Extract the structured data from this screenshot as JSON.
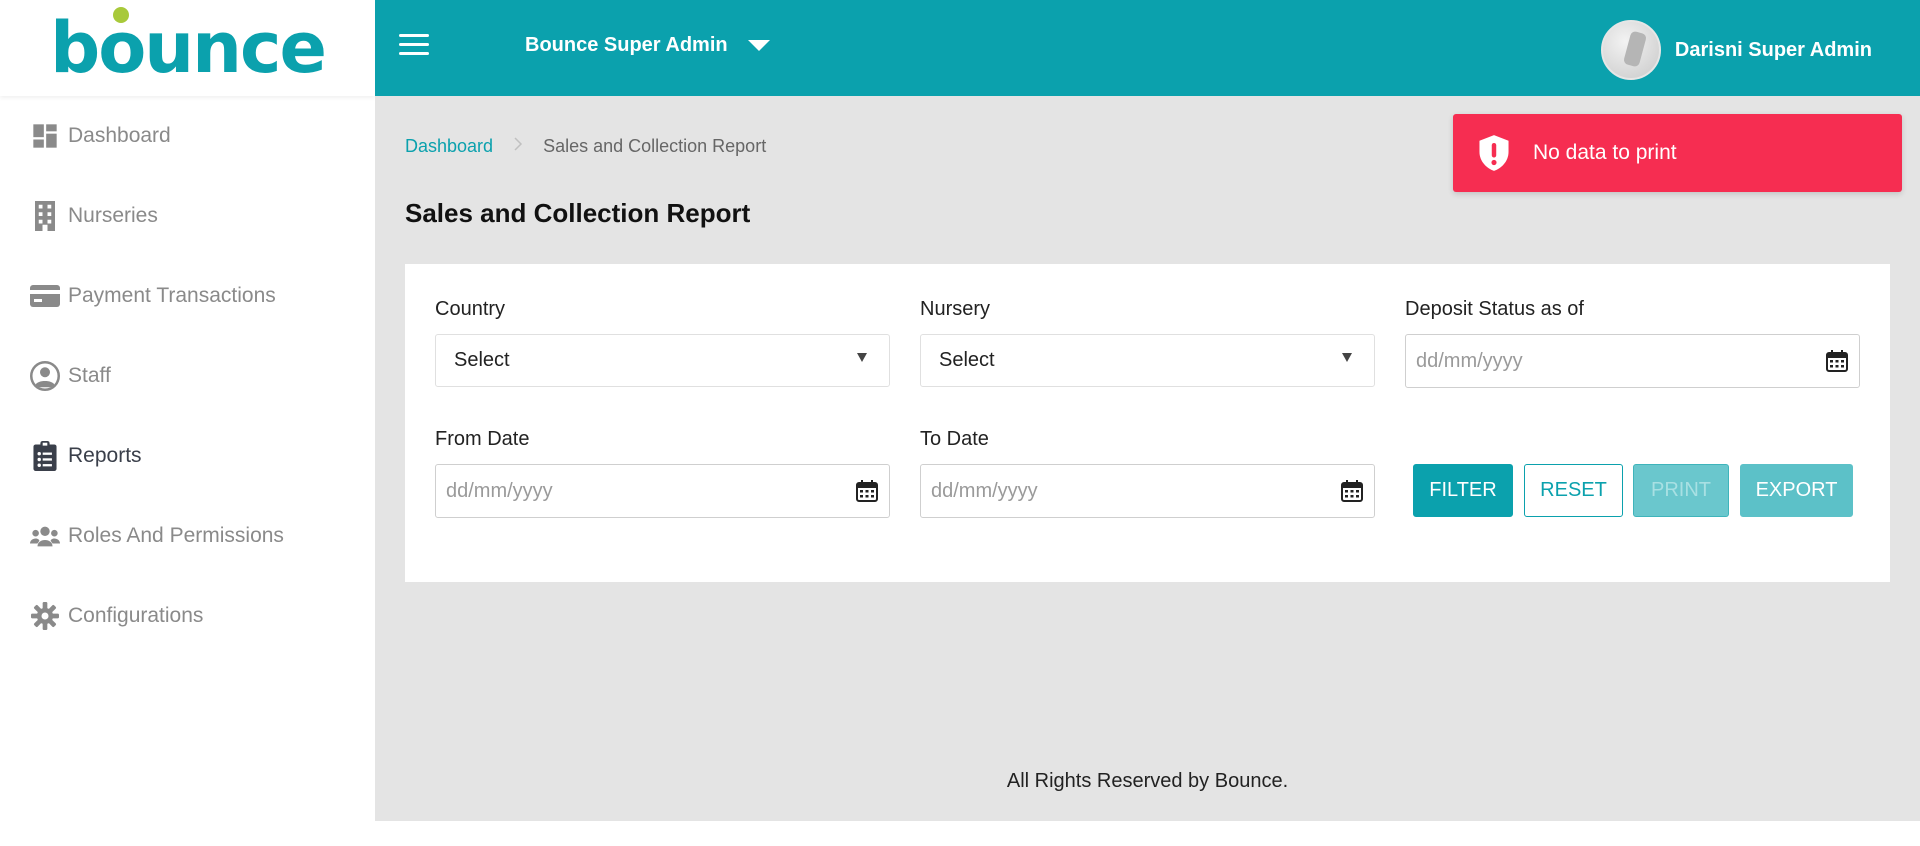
{
  "brand": {
    "logo_text_pre": "b",
    "logo_text_o": "o",
    "logo_text_post": "unce"
  },
  "sidebar": {
    "items": [
      {
        "label": "Dashboard",
        "icon": "dashboard-icon",
        "active": false
      },
      {
        "label": "Nurseries",
        "icon": "building-icon",
        "active": false
      },
      {
        "label": "Payment Transactions",
        "icon": "credit-card-icon",
        "active": false
      },
      {
        "label": "Staff",
        "icon": "user-circle-icon",
        "active": false
      },
      {
        "label": "Reports",
        "icon": "clipboard-list-icon",
        "active": true
      },
      {
        "label": "Roles And Permissions",
        "icon": "users-icon",
        "active": false
      },
      {
        "label": "Configurations",
        "icon": "gear-icon",
        "active": false
      }
    ]
  },
  "header": {
    "role_label": "Bounce Super Admin",
    "user_name": "Darisni Super Admin"
  },
  "breadcrumb": {
    "home": "Dashboard",
    "separator": ">",
    "current": "Sales and Collection Report"
  },
  "page": {
    "title": "Sales and Collection Report"
  },
  "filters": {
    "country": {
      "label": "Country",
      "value": "Select"
    },
    "nursery": {
      "label": "Nursery",
      "value": "Select"
    },
    "deposit_status": {
      "label": "Deposit Status as of",
      "placeholder": "dd/mm/yyyy"
    },
    "from_date": {
      "label": "From Date",
      "placeholder": "dd/mm/yyyy"
    },
    "to_date": {
      "label": "To Date",
      "placeholder": "dd/mm/yyyy"
    }
  },
  "actions": {
    "filter": "FILTER",
    "reset": "RESET",
    "print": "PRINT",
    "export": "EXPORT"
  },
  "footer": {
    "text": "All Rights Reserved by Bounce."
  },
  "toast": {
    "message": "No data to print",
    "icon": "shield-alert-icon"
  },
  "colors": {
    "primary": "#0ba1ad",
    "toast_error": "#f62d51",
    "content_bg": "#e4e4e4"
  }
}
